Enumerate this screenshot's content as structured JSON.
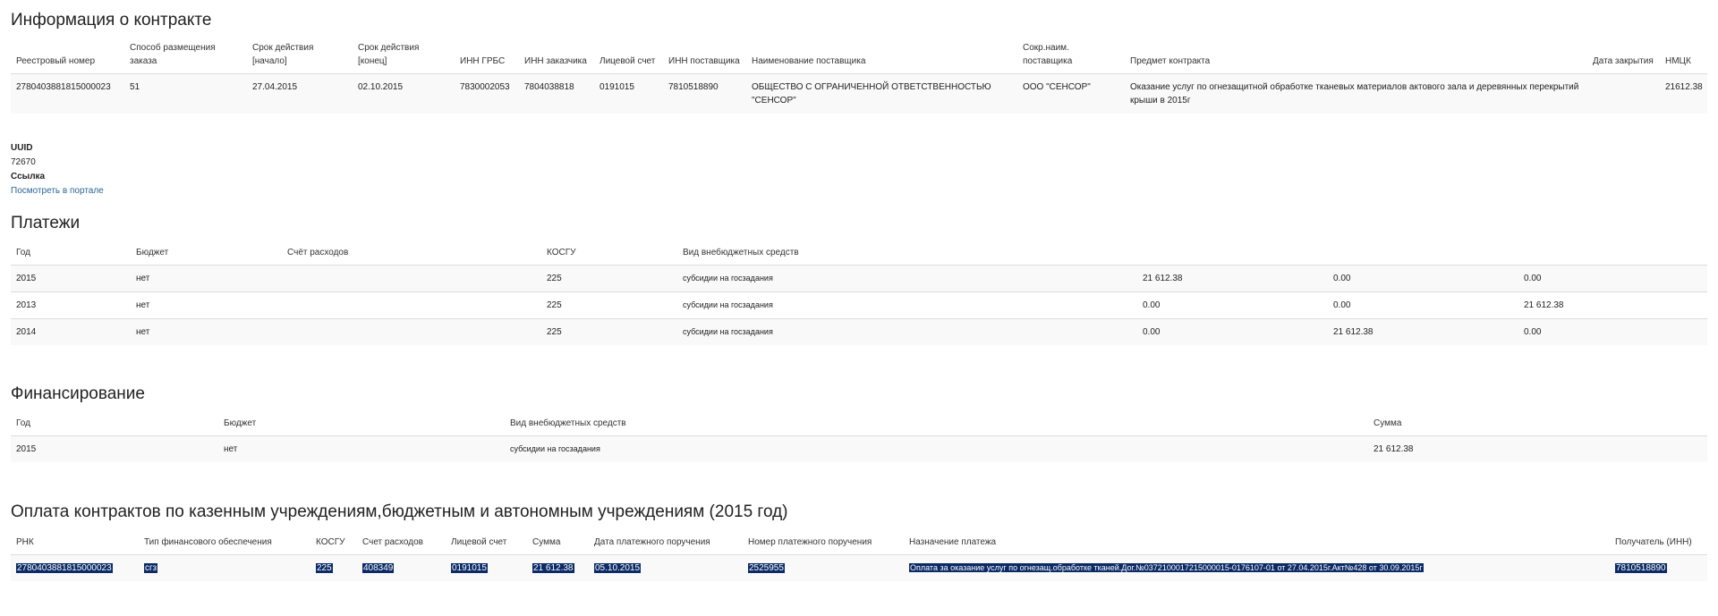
{
  "contract": {
    "title": "Информация о контракте",
    "headers": {
      "reg_num": "Реестровый номер",
      "method": "Способ размещения заказа",
      "start": "Срок действия [начало]",
      "end": "Срок действия [конец]",
      "inn_grbs": "ИНН ГРБС",
      "inn_customer": "ИНН заказчика",
      "account": "Лицевой счет",
      "inn_supplier": "ИНН поставщика",
      "supplier_name": "Наименование поставщика",
      "supplier_short": "Сокр.наим. поставщика",
      "subject": "Предмет контракта",
      "close_date": "Дата закрытия",
      "nmck": "НМЦК"
    },
    "row": {
      "reg_num": "2780403881815000023",
      "method": "51",
      "start": "27.04.2015",
      "end": "02.10.2015",
      "inn_grbs": "7830002053",
      "inn_customer": "7804038818",
      "account": "0191015",
      "inn_supplier": "7810518890",
      "supplier_name": "ОБЩЕСТВО С ОГРАНИЧЕННОЙ ОТВЕТСТВЕННОСТЬЮ \"СЕНСОР\"",
      "supplier_short": "ООО \"СЕНСОР\"",
      "subject": "Оказание услуг по огнезащитной обработке тканевых материалов актового зала и деревянных перекрытий крыши в 2015г",
      "close_date": "",
      "nmck": "21612.38"
    }
  },
  "meta": {
    "uuid_label": "UUID",
    "uuid_value": "72670",
    "link_label": "Ссылка",
    "link_text": "Посмотреть в портале"
  },
  "payments": {
    "title": "Платежи",
    "headers": {
      "year": "Год",
      "budget": "Бюджет",
      "expense": "Счёт расходов",
      "kosgu": "КОСГУ",
      "kind": "Вид внебюджетных средств"
    },
    "rows": [
      {
        "year": "2015",
        "budget": "нет",
        "expense": "",
        "kosgu": "225",
        "kind": "субсидии на госзадания",
        "v1": "21 612.38",
        "v2": "0.00",
        "v3": "0.00"
      },
      {
        "year": "2013",
        "budget": "нет",
        "expense": "",
        "kosgu": "225",
        "kind": "субсидии на госзадания",
        "v1": "0.00",
        "v2": "0.00",
        "v3": "21 612.38"
      },
      {
        "year": "2014",
        "budget": "нет",
        "expense": "",
        "kosgu": "225",
        "kind": "субсидии на госзадания",
        "v1": "0.00",
        "v2": "21 612.38",
        "v3": "0.00"
      }
    ]
  },
  "financing": {
    "title": "Финансирование",
    "headers": {
      "year": "Год",
      "budget": "Бюджет",
      "kind": "Вид внебюджетных средств",
      "sum": "Сумма"
    },
    "rows": [
      {
        "year": "2015",
        "budget": "нет",
        "kind": "субсидии на госзадания",
        "sum": "21 612.38"
      }
    ]
  },
  "paid": {
    "title": "Оплата контрактов по казенным учреждениям,бюджетным и автономным учреждениям (2015 год)",
    "headers": {
      "rnk": "РНК",
      "fin_type": "Тип финансового обеспечения",
      "kosgu": "КОСГУ",
      "expense": "Счет расходов",
      "account": "Лицевой счет",
      "sum": "Сумма",
      "order_date": "Дата платежного поручения",
      "order_num": "Номер платежного поручения",
      "purpose": "Назначение платежа",
      "recipient": "Получатель (ИНН)"
    },
    "rows": [
      {
        "rnk": "2780403881815000023",
        "fin_type": "сгз",
        "kosgu": "225",
        "expense": "408349",
        "account": "0191015",
        "sum": "21 612.38",
        "order_date": "05.10.2015",
        "order_num": "2525955",
        "purpose": "Оплата за оказание услуг по огнезащ.обработке тканей.Дог.№0372100017215000015-0176107-01 от 27.04.2015г.Акт№428 от 30.09.2015г",
        "recipient": "7810518890"
      }
    ]
  }
}
